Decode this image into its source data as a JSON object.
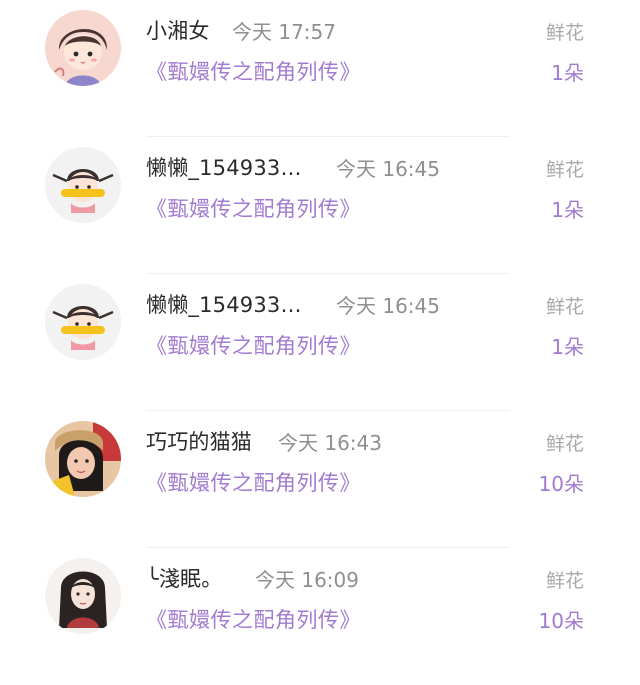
{
  "rows": [
    {
      "user": "小湘女",
      "time": "今天 17:57",
      "book": "《甄嬛传之配角列传》",
      "gift": "鲜花",
      "count": "1朵",
      "avatar": "cartoon-boy-avatar"
    },
    {
      "user": "懒懒_154933…",
      "time": "今天 16:45",
      "book": "《甄嬛传之配角列传》",
      "gift": "鲜花",
      "count": "1朵",
      "avatar": "cartoon-girl-avatar"
    },
    {
      "user": "懒懒_154933…",
      "time": "今天 16:45",
      "book": "《甄嬛传之配角列传》",
      "gift": "鲜花",
      "count": "1朵",
      "avatar": "cartoon-girl-avatar"
    },
    {
      "user": "巧巧的猫猫",
      "time": "今天 16:43",
      "book": "《甄嬛传之配角列传》",
      "gift": "鲜花",
      "count": "10朵",
      "avatar": "photo-avatar"
    },
    {
      "user": "╰淺眠。",
      "time": "今天 16:09",
      "book": "《甄嬛传之配角列传》",
      "gift": "鲜花",
      "count": "10朵",
      "avatar": "illustrated-girl-avatar"
    }
  ],
  "colors": {
    "accent": "#a27bd1",
    "name": "#2b2b2b",
    "meta": "#8f8f8f"
  }
}
